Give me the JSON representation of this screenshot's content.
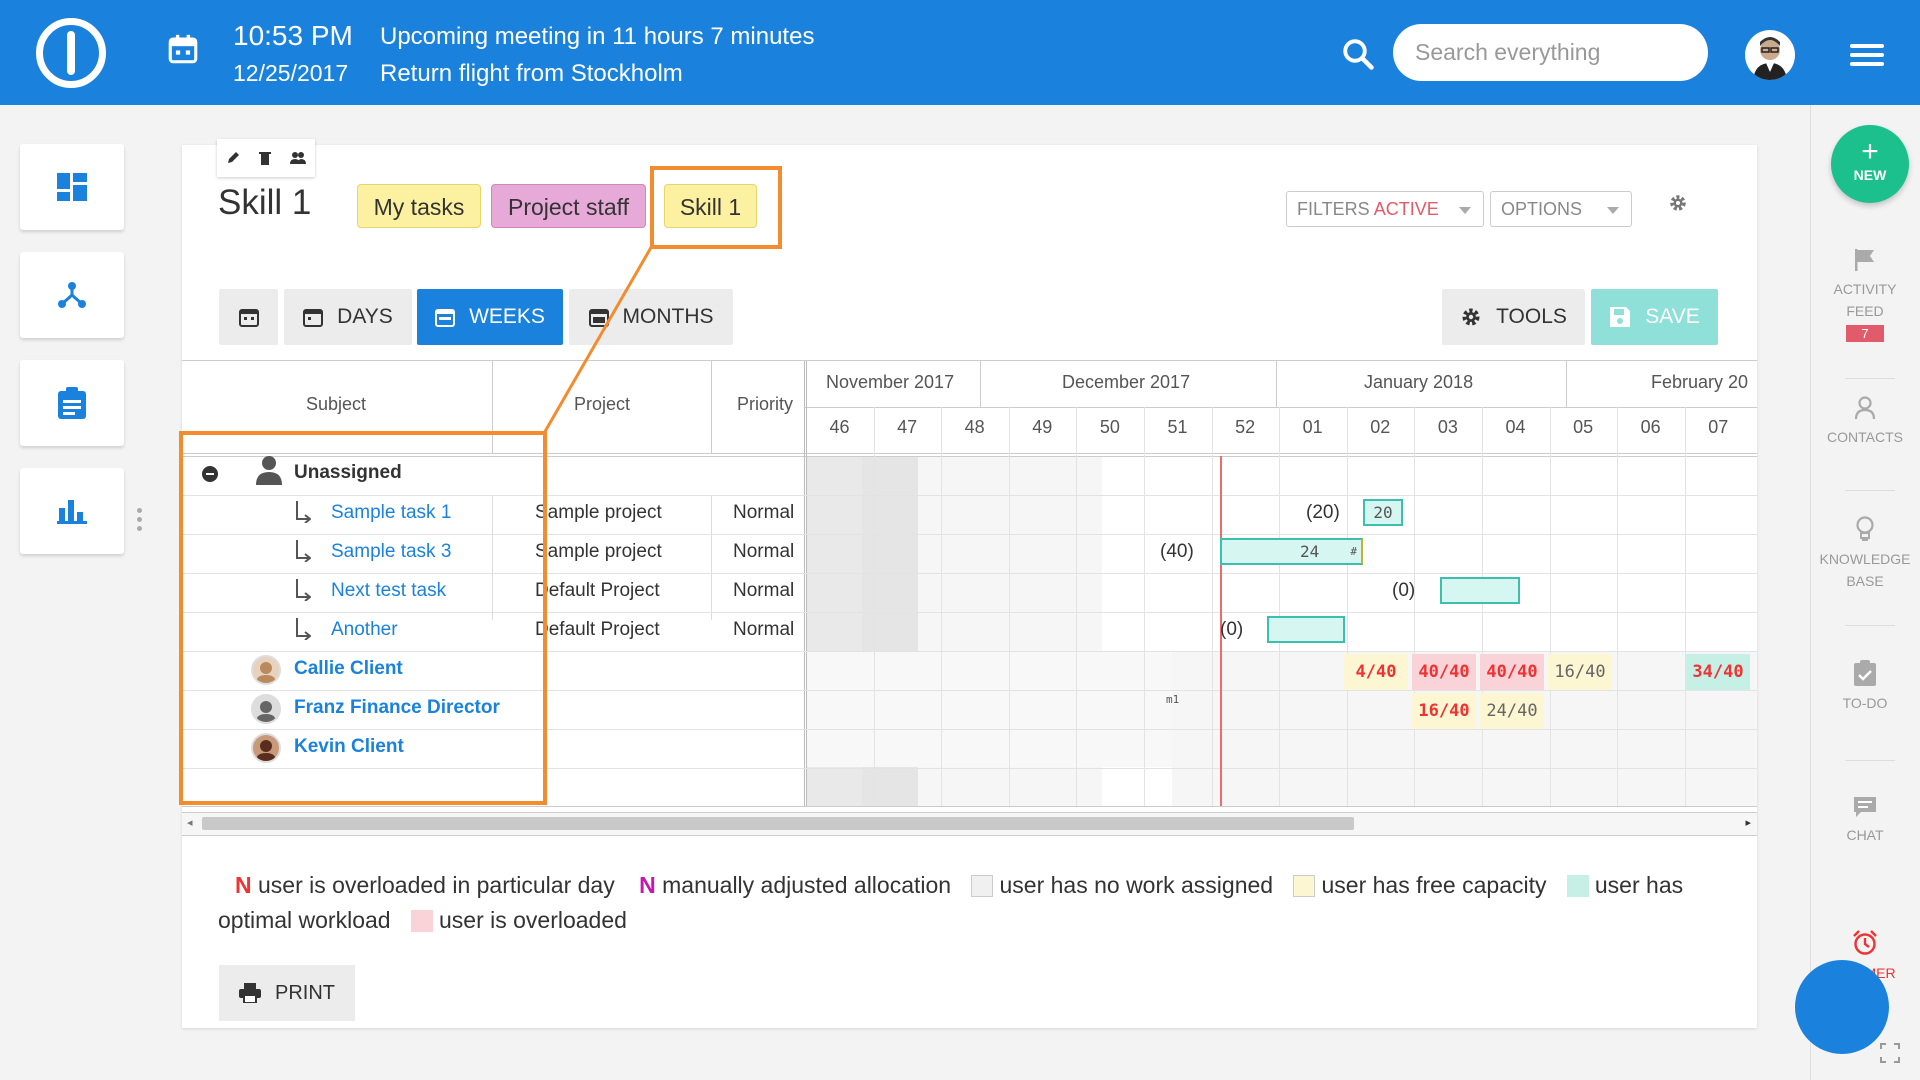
{
  "topbar": {
    "time": "10:53 PM",
    "date": "12/25/2017",
    "meeting": "Upcoming meeting in 11 hours 7 minutes",
    "flight": "Return flight from Stockholm",
    "search_placeholder": "Search everything"
  },
  "sidebar_right": {
    "new_label": "NEW",
    "activity": [
      "ACTIVITY",
      "FEED"
    ],
    "activity_badge": "7",
    "contacts": "CONTACTS",
    "knowledge": [
      "KNOWLEDGE",
      "BASE"
    ],
    "todo": "TO-DO",
    "chat": "CHAT",
    "timer": "MER"
  },
  "page": {
    "title": "Skill 1",
    "tags": [
      "My tasks",
      "Project staff",
      "Skill 1"
    ],
    "filters_label": "FILTERS",
    "filters_active": "ACTIVE",
    "options_label": "OPTIONS"
  },
  "toolbar": {
    "days": "DAYS",
    "weeks": "WEEKS",
    "months": "MONTHS",
    "tools": "TOOLS",
    "save": "SAVE"
  },
  "table": {
    "headers": {
      "subject": "Subject",
      "project": "Project",
      "priority": "Priority"
    },
    "months": [
      "November 2017",
      "December 2017",
      "January 2018",
      "February 20"
    ],
    "weeks": [
      "46",
      "47",
      "48",
      "49",
      "50",
      "51",
      "52",
      "01",
      "02",
      "03",
      "04",
      "05",
      "06",
      "07"
    ],
    "group": "Unassigned",
    "tasks": [
      {
        "subject": "Sample task 1",
        "project": "Sample project",
        "priority": "Normal",
        "label": "(20)",
        "bar": "20"
      },
      {
        "subject": "Sample task 3",
        "project": "Sample project",
        "priority": "Normal",
        "label": "(40)",
        "bar": "24",
        "bar_mark": "#"
      },
      {
        "subject": "Next test task",
        "project": "Default Project",
        "priority": "Normal",
        "label": "(0)",
        "bar": ""
      },
      {
        "subject": "Another",
        "project": "Default Project",
        "priority": "Normal",
        "label": "(0)",
        "bar": ""
      }
    ],
    "users": [
      {
        "name": "Callie Client",
        "loads": [
          "4/40",
          "40/40",
          "40/40",
          "16/40",
          "34/40"
        ]
      },
      {
        "name": "Franz Finance Director",
        "loads": [
          "16/40",
          "24/40"
        ],
        "mark": "m1"
      },
      {
        "name": "Kevin Client",
        "loads": []
      }
    ]
  },
  "legend": {
    "n1": "N",
    "t1": "user is overloaded in particular day",
    "n2": "N",
    "t2": "manually adjusted allocation",
    "t3": "user has no work assigned",
    "t4": "user has free capacity",
    "t5": "user has optimal workload",
    "t6": "user is overloaded",
    "colors": {
      "no_work": "#f0f0f0",
      "free": "#fdf6d2",
      "optimal": "#c6efe6",
      "overloaded": "#fad3d8"
    }
  },
  "print_label": "PRINT"
}
